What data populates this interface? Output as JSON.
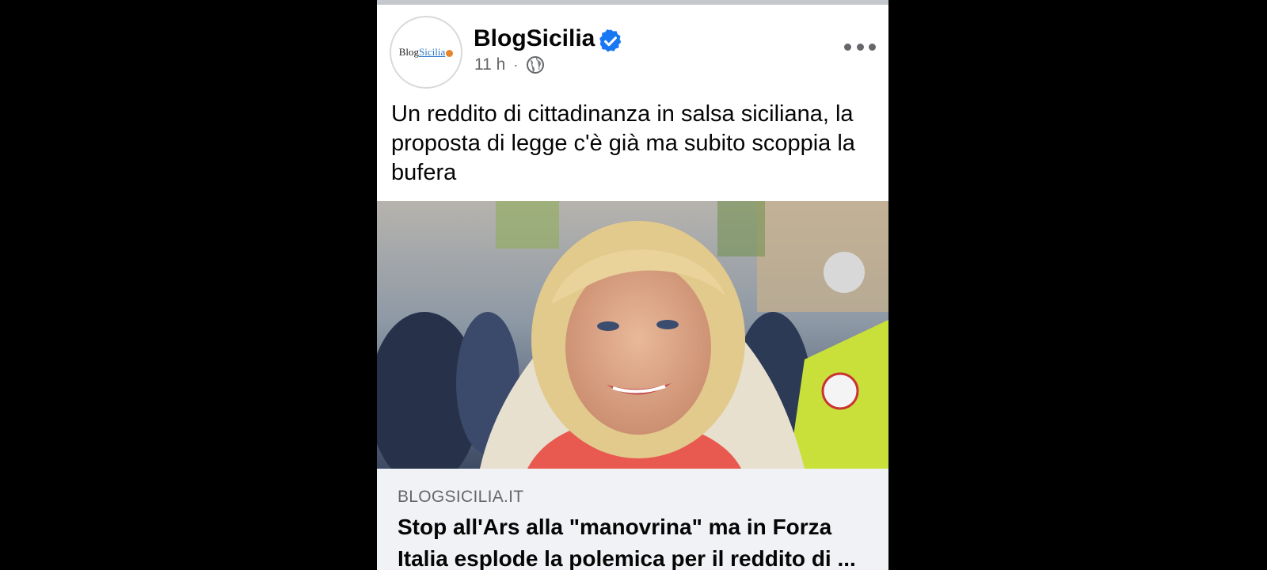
{
  "post": {
    "page_name": "BlogSicilia",
    "avatar_logo": {
      "blog": "Blog",
      "sicilia": "Sicilia"
    },
    "time": "11 h",
    "separator": "·",
    "text": "Un reddito di cittadinanza in salsa siciliana, la proposta di legge c'è già ma subito scoppia la bufera"
  },
  "link_preview": {
    "domain": "BLOGSICILIA.IT",
    "title": "Stop all'Ars alla \"manovrina\" ma in Forza Italia esplode la polemica per il reddito di ..."
  },
  "icons": {
    "verified": "verified-badge-icon",
    "audience": "globe-icon",
    "more": "more-options-icon"
  },
  "colors": {
    "verified_blue": "#1877f2",
    "meta_gray": "#65676b",
    "link_bg": "#f0f2f5"
  }
}
